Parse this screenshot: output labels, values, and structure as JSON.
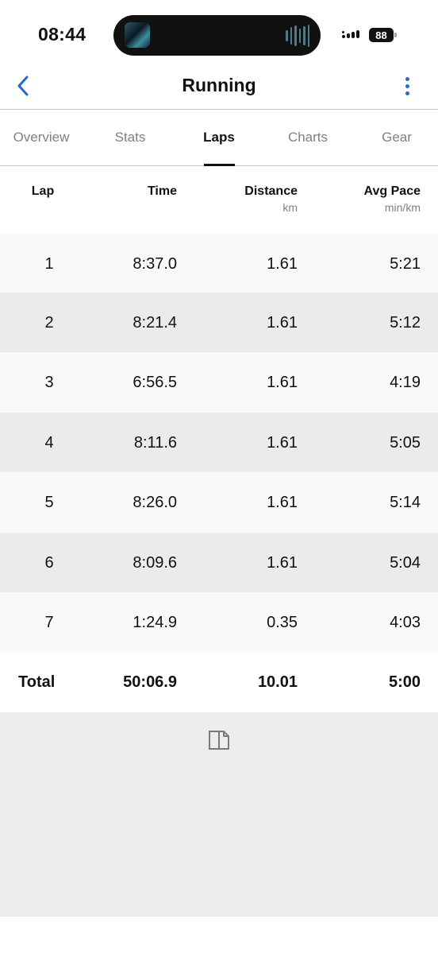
{
  "status_bar": {
    "time": "08:44",
    "battery": "88"
  },
  "nav": {
    "title": "Running",
    "accent_color": "#1a6fd0"
  },
  "tabs": [
    {
      "label": "Overview",
      "active": false
    },
    {
      "label": "Stats",
      "active": false
    },
    {
      "label": "Laps",
      "active": true
    },
    {
      "label": "Charts",
      "active": false
    },
    {
      "label": "Gear",
      "active": false
    }
  ],
  "table": {
    "columns": [
      {
        "label": "Lap",
        "unit": ""
      },
      {
        "label": "Time",
        "unit": ""
      },
      {
        "label": "Distance",
        "unit": "km"
      },
      {
        "label": "Avg Pace",
        "unit": "min/km"
      }
    ],
    "rows": [
      {
        "lap": "1",
        "time": "8:37.0",
        "distance": "1.61",
        "pace": "5:21"
      },
      {
        "lap": "2",
        "time": "8:21.4",
        "distance": "1.61",
        "pace": "5:12"
      },
      {
        "lap": "3",
        "time": "6:56.5",
        "distance": "1.61",
        "pace": "4:19"
      },
      {
        "lap": "4",
        "time": "8:11.6",
        "distance": "1.61",
        "pace": "5:05"
      },
      {
        "lap": "5",
        "time": "8:26.0",
        "distance": "1.61",
        "pace": "5:14"
      },
      {
        "lap": "6",
        "time": "8:09.6",
        "distance": "1.61",
        "pace": "5:04"
      },
      {
        "lap": "7",
        "time": "1:24.9",
        "distance": "0.35",
        "pace": "4:03"
      }
    ],
    "total": {
      "lap": "Total",
      "time": "50:06.9",
      "distance": "10.01",
      "pace": "5:00"
    }
  },
  "icons": {
    "back": "chevron-left-icon",
    "more": "more-vertical-icon",
    "footer": "document-export-icon"
  }
}
